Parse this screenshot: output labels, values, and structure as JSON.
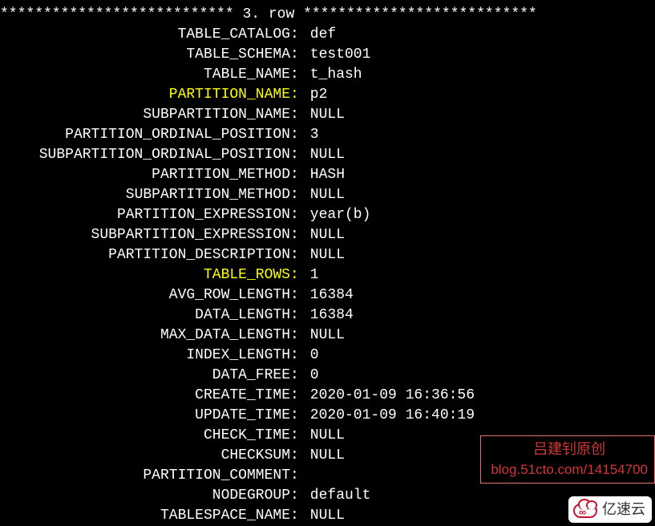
{
  "header": {
    "stars_left": "***************************",
    "row_label": " 3. row ",
    "stars_right": "***************************"
  },
  "fields": [
    {
      "label": "TABLE_CATALOG",
      "value": "def",
      "highlight": false
    },
    {
      "label": "TABLE_SCHEMA",
      "value": "test001",
      "highlight": false
    },
    {
      "label": "TABLE_NAME",
      "value": "t_hash",
      "highlight": false
    },
    {
      "label": "PARTITION_NAME",
      "value": "p2",
      "highlight": true
    },
    {
      "label": "SUBPARTITION_NAME",
      "value": "NULL",
      "highlight": false
    },
    {
      "label": "PARTITION_ORDINAL_POSITION",
      "value": "3",
      "highlight": false
    },
    {
      "label": "SUBPARTITION_ORDINAL_POSITION",
      "value": "NULL",
      "highlight": false
    },
    {
      "label": "PARTITION_METHOD",
      "value": "HASH",
      "highlight": false
    },
    {
      "label": "SUBPARTITION_METHOD",
      "value": "NULL",
      "highlight": false
    },
    {
      "label": "PARTITION_EXPRESSION",
      "value": "year(b)",
      "highlight": false
    },
    {
      "label": "SUBPARTITION_EXPRESSION",
      "value": "NULL",
      "highlight": false
    },
    {
      "label": "PARTITION_DESCRIPTION",
      "value": "NULL",
      "highlight": false
    },
    {
      "label": "TABLE_ROWS",
      "value": "1",
      "highlight": true
    },
    {
      "label": "AVG_ROW_LENGTH",
      "value": "16384",
      "highlight": false
    },
    {
      "label": "DATA_LENGTH",
      "value": "16384",
      "highlight": false
    },
    {
      "label": "MAX_DATA_LENGTH",
      "value": "NULL",
      "highlight": false
    },
    {
      "label": "INDEX_LENGTH",
      "value": "0",
      "highlight": false
    },
    {
      "label": "DATA_FREE",
      "value": "0",
      "highlight": false
    },
    {
      "label": "CREATE_TIME",
      "value": "2020-01-09 16:36:56",
      "highlight": false
    },
    {
      "label": "UPDATE_TIME",
      "value": "2020-01-09 16:40:19",
      "highlight": false
    },
    {
      "label": "CHECK_TIME",
      "value": "NULL",
      "highlight": false
    },
    {
      "label": "CHECKSUM",
      "value": "NULL",
      "highlight": false
    },
    {
      "label": "PARTITION_COMMENT",
      "value": "",
      "highlight": false
    },
    {
      "label": "NODEGROUP",
      "value": "default",
      "highlight": false
    },
    {
      "label": "TABLESPACE_NAME",
      "value": "NULL",
      "highlight": false
    }
  ],
  "watermark": {
    "line1": "吕建钊原创",
    "line2": "blog.51cto.com/14154700"
  },
  "logo": {
    "text": "亿速云"
  }
}
